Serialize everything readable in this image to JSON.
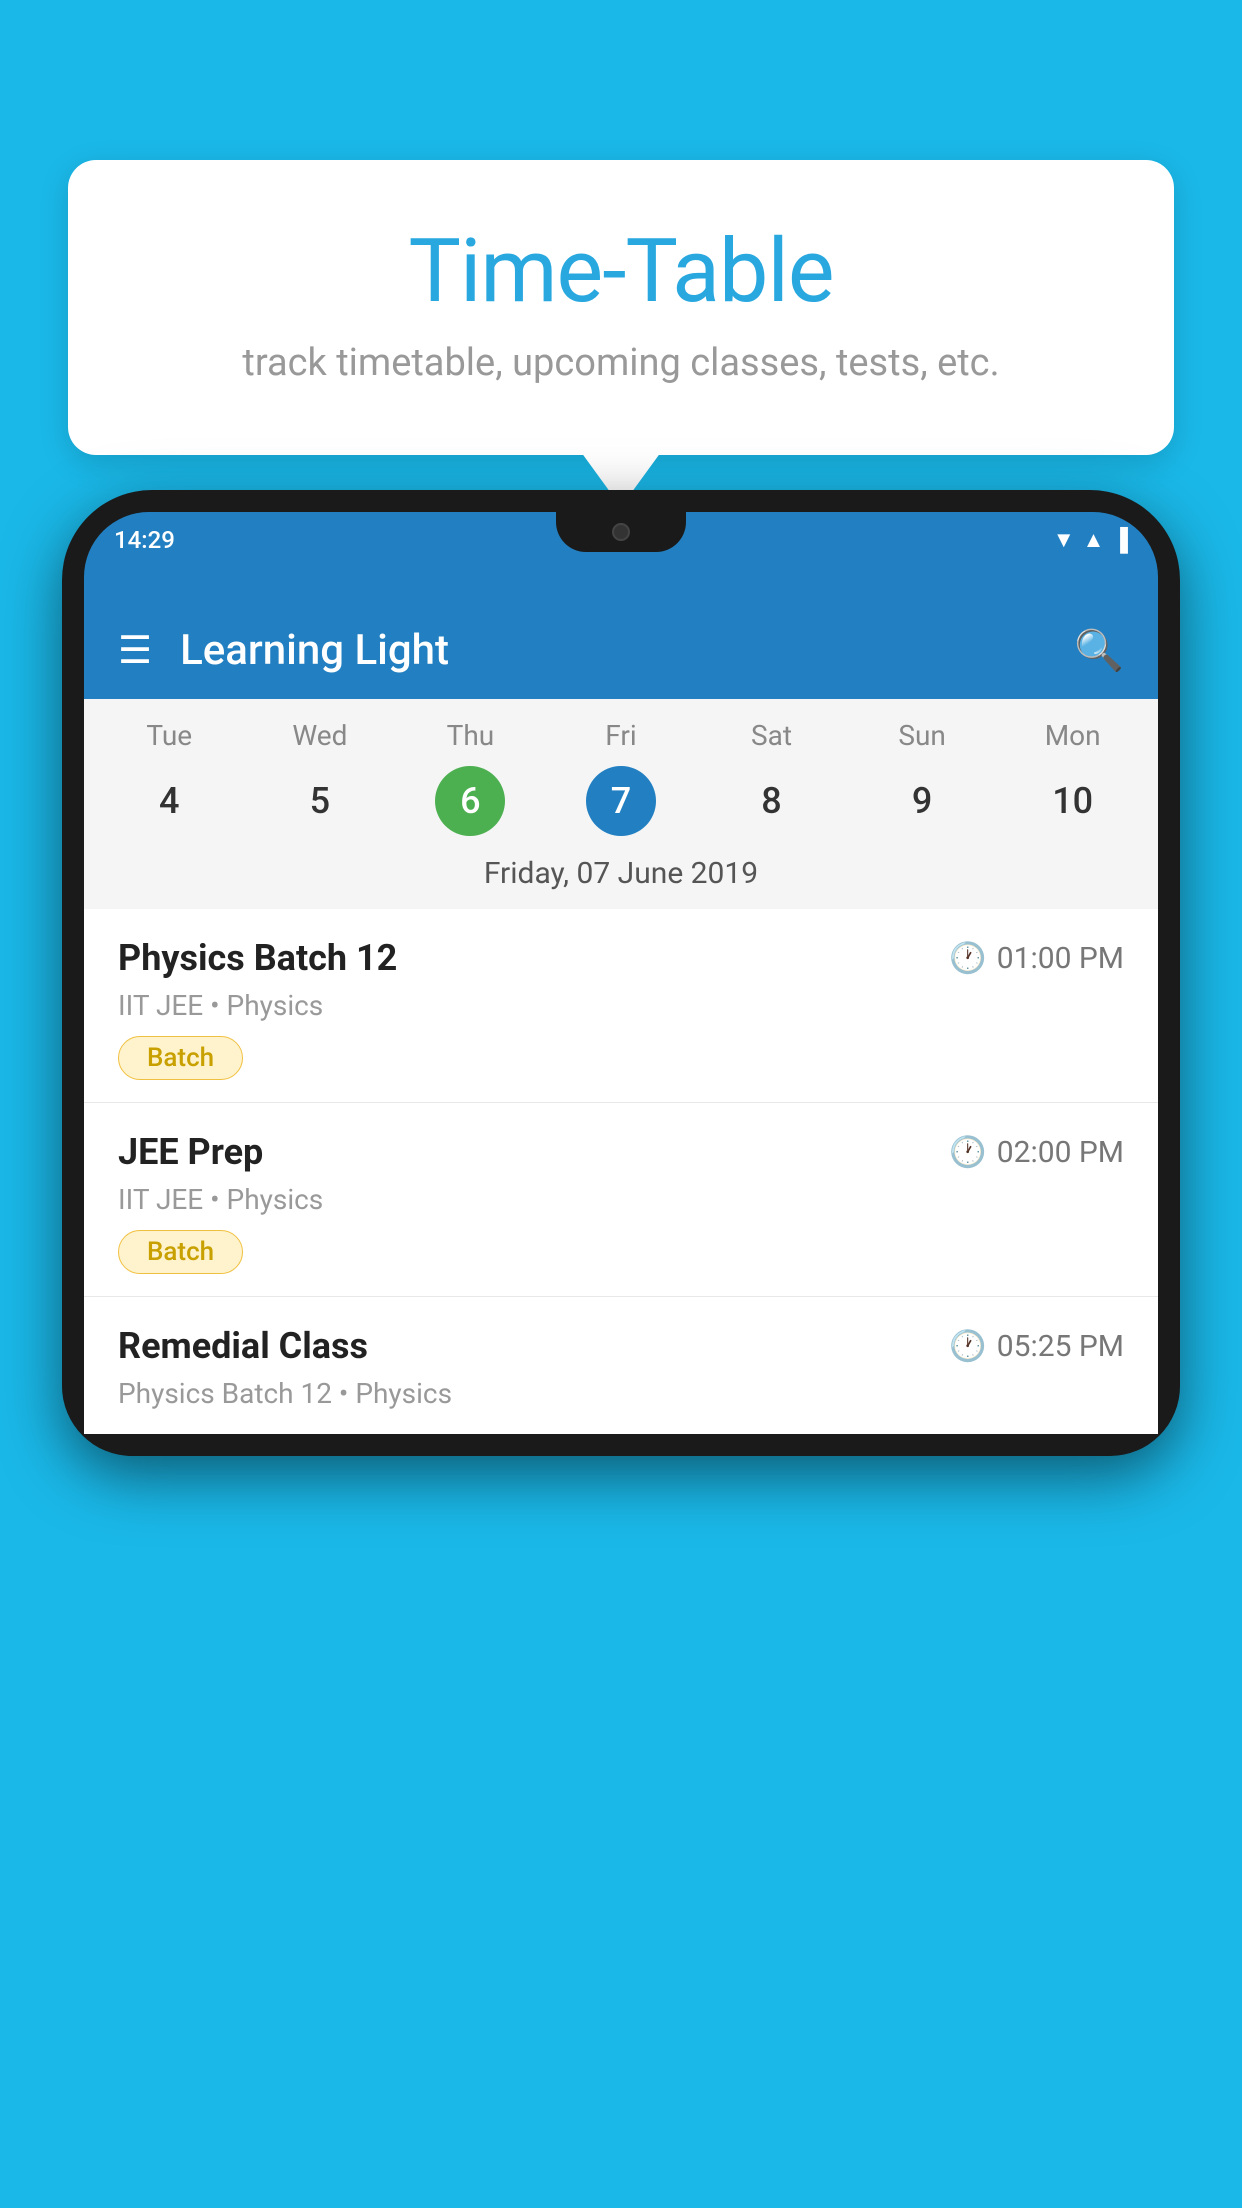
{
  "background_color": "#1ab8e8",
  "tooltip": {
    "title": "Time-Table",
    "subtitle": "track timetable, upcoming classes, tests, etc."
  },
  "phone": {
    "status_bar": {
      "time": "14:29",
      "wifi_icon": "wifi",
      "signal_icon": "signal",
      "battery_icon": "battery"
    },
    "app_bar": {
      "title": "Learning Light",
      "menu_icon": "hamburger",
      "search_icon": "search"
    },
    "calendar": {
      "days": [
        {
          "name": "Tue",
          "num": "4",
          "state": "normal"
        },
        {
          "name": "Wed",
          "num": "5",
          "state": "normal"
        },
        {
          "name": "Thu",
          "num": "6",
          "state": "today"
        },
        {
          "name": "Fri",
          "num": "7",
          "state": "selected"
        },
        {
          "name": "Sat",
          "num": "8",
          "state": "normal"
        },
        {
          "name": "Sun",
          "num": "9",
          "state": "normal"
        },
        {
          "name": "Mon",
          "num": "10",
          "state": "normal"
        }
      ],
      "selected_date_label": "Friday, 07 June 2019"
    },
    "schedule": [
      {
        "title": "Physics Batch 12",
        "time": "01:00 PM",
        "subtitle": "IIT JEE • Physics",
        "badge": "Batch"
      },
      {
        "title": "JEE Prep",
        "time": "02:00 PM",
        "subtitle": "IIT JEE • Physics",
        "badge": "Batch"
      },
      {
        "title": "Remedial Class",
        "time": "05:25 PM",
        "subtitle": "Physics Batch 12 • Physics",
        "badge": null
      }
    ]
  }
}
